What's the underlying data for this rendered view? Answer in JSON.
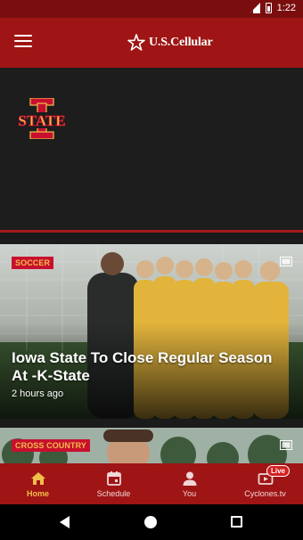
{
  "status_bar": {
    "time": "1:22"
  },
  "app_bar": {
    "brand": "U.S.Cellular"
  },
  "hero": {
    "logo_text": "STATE"
  },
  "cards": [
    {
      "badge": "SOCCER",
      "headline": "Iowa State To Close Regular Season At -K-State",
      "time_ago": "2 hours ago"
    },
    {
      "badge": "CROSS COUNTRY"
    }
  ],
  "bottom_nav": {
    "items": [
      {
        "label": "Home",
        "active": true
      },
      {
        "label": "Schedule"
      },
      {
        "label": "You"
      },
      {
        "label": "Cyclones.tv",
        "badge": "Live"
      }
    ]
  },
  "colors": {
    "brand_red": "#9f1515",
    "accent_gold": "#f1be48",
    "badge_red": "#c8102e"
  }
}
